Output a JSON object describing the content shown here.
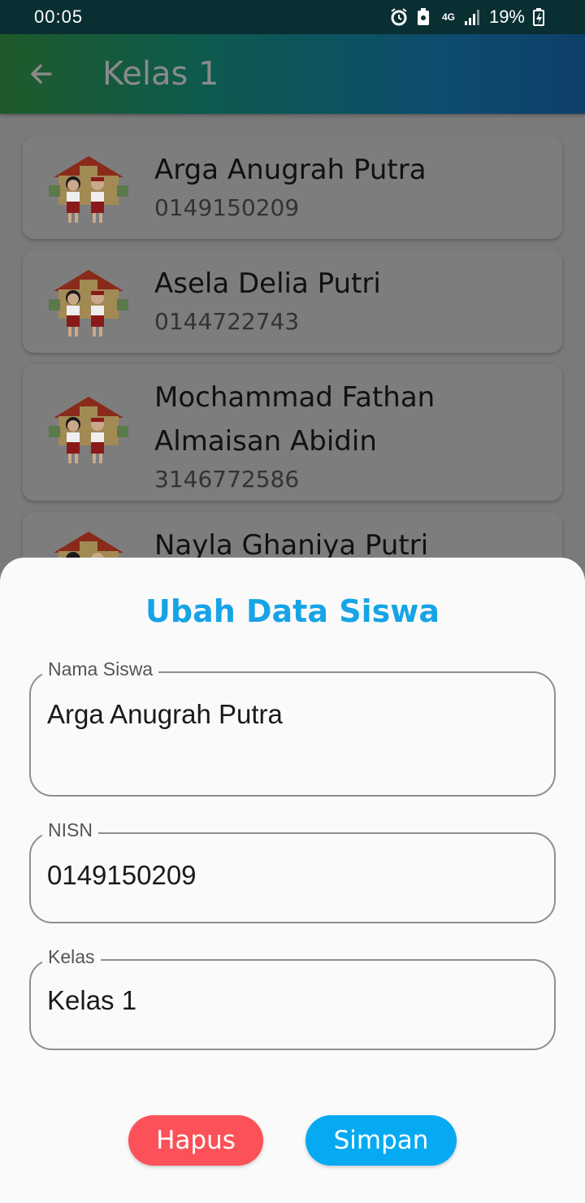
{
  "status_bar": {
    "time": "00:05",
    "battery": "19%",
    "network": "4G",
    "icons": [
      "alarm-icon",
      "battery-saver-icon",
      "network-4g-icon",
      "signal-icon",
      "battery-icon"
    ]
  },
  "app_bar": {
    "title": "Kelas 1",
    "back_icon": "arrow-left-icon"
  },
  "students": [
    {
      "name": "Arga Anugrah Putra",
      "nisn": "0149150209"
    },
    {
      "name": "Asela Delia Putri",
      "nisn": "0144722743"
    },
    {
      "name": "Mochammad Fathan Almaisan Abidin",
      "name_line1": "Mochammad Fathan",
      "name_line2": "Almaisan Abidin",
      "nisn": "3146772586"
    },
    {
      "name": "Nayla Ghaniya Putri",
      "nisn": ""
    }
  ],
  "sheet": {
    "title": "Ubah Data Siswa",
    "fields": {
      "nama": {
        "label": "Nama Siswa",
        "value": "Arga Anugrah Putra"
      },
      "nisn": {
        "label": "NISN",
        "value": "0149150209"
      },
      "kelas": {
        "label": "Kelas",
        "value": "Kelas 1"
      }
    },
    "buttons": {
      "delete": "Hapus",
      "save": "Simpan"
    }
  },
  "colors": {
    "accent": "#16a4e6",
    "delete": "#fc5158",
    "save": "#06aaf2",
    "status_bar": "#0a2f33"
  }
}
